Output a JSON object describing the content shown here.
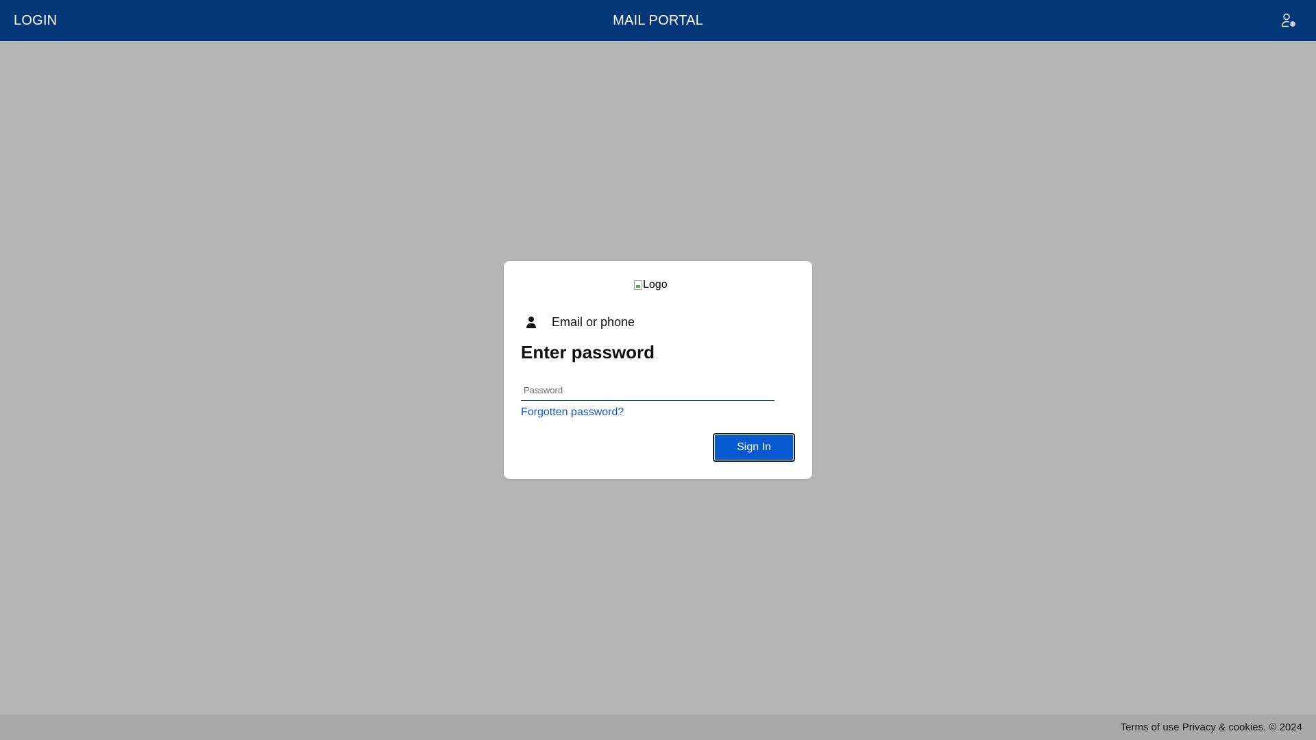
{
  "header": {
    "left_label": "LOGIN",
    "title": "MAIL PORTAL",
    "account_icon": "account-settings-icon"
  },
  "card": {
    "logo_alt": "Logo",
    "identity_icon": "person-icon",
    "identity_text": "Email or phone",
    "title": "Enter password",
    "password_placeholder": "Password",
    "password_value": "",
    "forgot_label": "Forgotten password?",
    "signin_label": "Sign In"
  },
  "footer": {
    "terms_label": "Terms of use",
    "privacy_label": "Privacy & cookies.",
    "copyright": "© 2024"
  },
  "colors": {
    "header_bg": "#053878",
    "page_bg": "#b5b5b5",
    "footer_bg": "#a9a9a9",
    "button_bg": "#0759cf",
    "link": "#0b5bd3"
  }
}
